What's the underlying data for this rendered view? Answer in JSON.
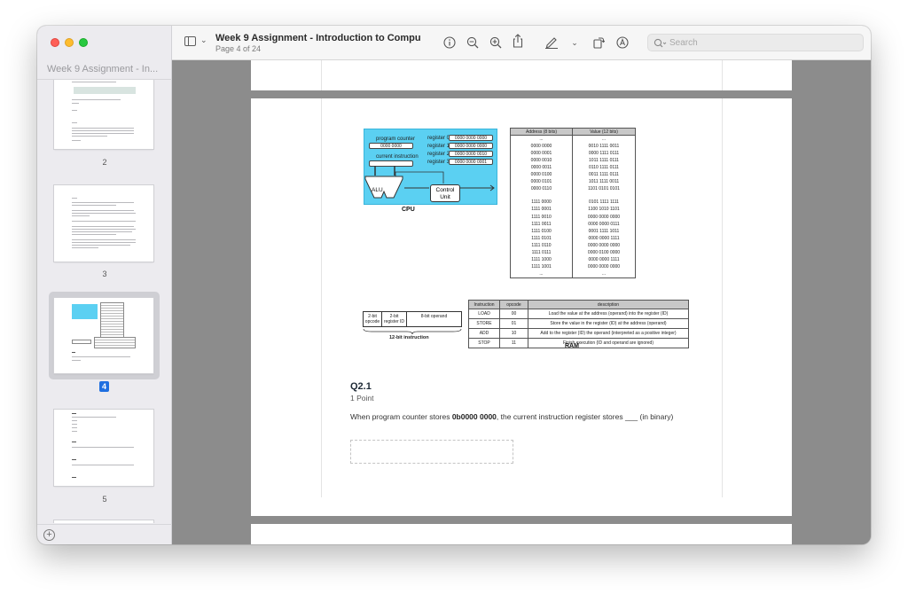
{
  "window": {
    "title": "Week 9 Assignment - Introduction to Compu...",
    "subtitle": "Page 4 of 24"
  },
  "sidebar": {
    "title": "Week 9 Assignment - In...",
    "pages": [
      {
        "label": "2"
      },
      {
        "label": "3"
      },
      {
        "label": "4",
        "selected": true
      },
      {
        "label": "5"
      }
    ]
  },
  "toolbar": {
    "search_placeholder": "Search",
    "icons": [
      "sidebar-toggle-icon",
      "info-icon",
      "zoom-out-icon",
      "zoom-in-icon",
      "share-icon",
      "markup-pen-icon",
      "rotate-icon",
      "annotate-icon",
      "search-icon"
    ]
  },
  "figure": {
    "cpu": {
      "program_counter_label": "program counter",
      "program_counter_value": "0000 0000",
      "current_instruction_label": "current instruction",
      "registers": [
        {
          "label": "register 0",
          "value": "0000 0000 0000"
        },
        {
          "label": "register 1",
          "value": "0000 0000 0000"
        },
        {
          "label": "register 2",
          "value": "0000 0000 0010"
        },
        {
          "label": "register 3",
          "value": "0000 0000 0001"
        }
      ],
      "alu": "ALU",
      "control_unit": "Control Unit",
      "caption": "CPU"
    },
    "ram": {
      "headers": [
        "Address (8 bits)",
        "Value (12 bits)"
      ],
      "rows_top": [
        [
          "...",
          "..."
        ],
        [
          "0000 0000",
          "0010 1111 0011"
        ],
        [
          "0000 0001",
          "0000 1111 0111"
        ],
        [
          "0000 0010",
          "1011 1111 0111"
        ],
        [
          "0000 0011",
          "0110 1111 0111"
        ],
        [
          "0000 0100",
          "0011 1111 0111"
        ],
        [
          "0000 0101",
          "1011 1111 0011"
        ],
        [
          "0000 0110",
          "1101 0101 0101"
        ]
      ],
      "rows_bottom": [
        [
          "1111 0000",
          "0101 1111 1111"
        ],
        [
          "1111 0001",
          "1100 1010 1101"
        ],
        [
          "1111 0010",
          "0000 0000 0000"
        ],
        [
          "1111 0011",
          "0000 0000 0111"
        ],
        [
          "1111 0100",
          "0001 1111 1011"
        ],
        [
          "1111 0101",
          "0000 0000 1111"
        ],
        [
          "1111 0110",
          "0000 0000 0000"
        ],
        [
          "1111 0111",
          "0000 0100 0000"
        ],
        [
          "1111 1000",
          "0000 0000 1111"
        ],
        [
          "1111 1001",
          "0000 0000 0000"
        ],
        [
          "...",
          "..."
        ]
      ],
      "caption": "RAM"
    },
    "instruction": {
      "fields": [
        "2-bit opcode",
        "2-bit register ID",
        "8-bit operand"
      ],
      "caption": "12-bit instruction"
    },
    "opcode_table": {
      "headers": [
        "Instruction",
        "opcode",
        "description"
      ],
      "rows": [
        [
          "LOAD",
          "00",
          "Load the value at the address (operand) into the register (ID)"
        ],
        [
          "STORE",
          "01",
          "Store the value in the register (ID) at the address (operand)"
        ],
        [
          "ADD",
          "10",
          "Add to the register (ID) the operand (interpreted as a positive integer)"
        ],
        [
          "STOP",
          "11",
          "Finish execution (ID and operand are ignored)"
        ]
      ]
    }
  },
  "question": {
    "title": "Q2.1",
    "points": "1 Point",
    "text_before": "When program counter stores ",
    "text_bold": "0b0000 0000",
    "text_after": ", the current instruction register stores ___ (in binary)"
  }
}
